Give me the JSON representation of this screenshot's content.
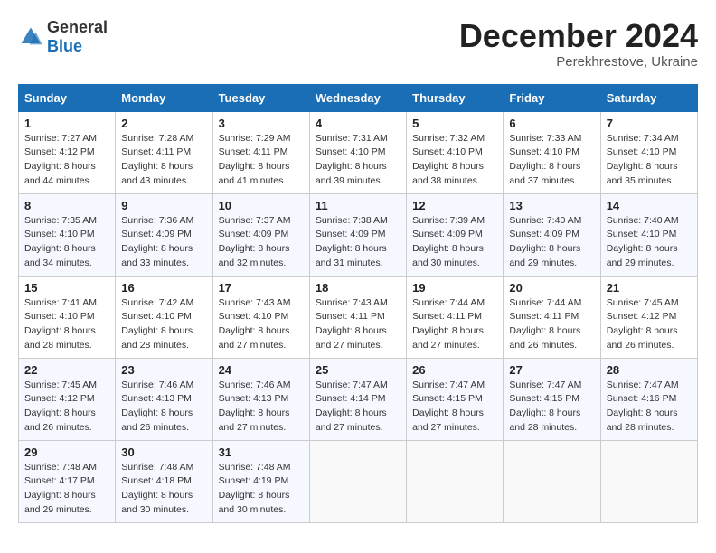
{
  "header": {
    "logo_general": "General",
    "logo_blue": "Blue",
    "title": "December 2024",
    "subtitle": "Perekhrestove, Ukraine"
  },
  "days_of_week": [
    "Sunday",
    "Monday",
    "Tuesday",
    "Wednesday",
    "Thursday",
    "Friday",
    "Saturday"
  ],
  "weeks": [
    [
      {
        "day": "1",
        "sunrise": "Sunrise: 7:27 AM",
        "sunset": "Sunset: 4:12 PM",
        "daylight": "Daylight: 8 hours and 44 minutes."
      },
      {
        "day": "2",
        "sunrise": "Sunrise: 7:28 AM",
        "sunset": "Sunset: 4:11 PM",
        "daylight": "Daylight: 8 hours and 43 minutes."
      },
      {
        "day": "3",
        "sunrise": "Sunrise: 7:29 AM",
        "sunset": "Sunset: 4:11 PM",
        "daylight": "Daylight: 8 hours and 41 minutes."
      },
      {
        "day": "4",
        "sunrise": "Sunrise: 7:31 AM",
        "sunset": "Sunset: 4:10 PM",
        "daylight": "Daylight: 8 hours and 39 minutes."
      },
      {
        "day": "5",
        "sunrise": "Sunrise: 7:32 AM",
        "sunset": "Sunset: 4:10 PM",
        "daylight": "Daylight: 8 hours and 38 minutes."
      },
      {
        "day": "6",
        "sunrise": "Sunrise: 7:33 AM",
        "sunset": "Sunset: 4:10 PM",
        "daylight": "Daylight: 8 hours and 37 minutes."
      },
      {
        "day": "7",
        "sunrise": "Sunrise: 7:34 AM",
        "sunset": "Sunset: 4:10 PM",
        "daylight": "Daylight: 8 hours and 35 minutes."
      }
    ],
    [
      {
        "day": "8",
        "sunrise": "Sunrise: 7:35 AM",
        "sunset": "Sunset: 4:10 PM",
        "daylight": "Daylight: 8 hours and 34 minutes."
      },
      {
        "day": "9",
        "sunrise": "Sunrise: 7:36 AM",
        "sunset": "Sunset: 4:09 PM",
        "daylight": "Daylight: 8 hours and 33 minutes."
      },
      {
        "day": "10",
        "sunrise": "Sunrise: 7:37 AM",
        "sunset": "Sunset: 4:09 PM",
        "daylight": "Daylight: 8 hours and 32 minutes."
      },
      {
        "day": "11",
        "sunrise": "Sunrise: 7:38 AM",
        "sunset": "Sunset: 4:09 PM",
        "daylight": "Daylight: 8 hours and 31 minutes."
      },
      {
        "day": "12",
        "sunrise": "Sunrise: 7:39 AM",
        "sunset": "Sunset: 4:09 PM",
        "daylight": "Daylight: 8 hours and 30 minutes."
      },
      {
        "day": "13",
        "sunrise": "Sunrise: 7:40 AM",
        "sunset": "Sunset: 4:09 PM",
        "daylight": "Daylight: 8 hours and 29 minutes."
      },
      {
        "day": "14",
        "sunrise": "Sunrise: 7:40 AM",
        "sunset": "Sunset: 4:10 PM",
        "daylight": "Daylight: 8 hours and 29 minutes."
      }
    ],
    [
      {
        "day": "15",
        "sunrise": "Sunrise: 7:41 AM",
        "sunset": "Sunset: 4:10 PM",
        "daylight": "Daylight: 8 hours and 28 minutes."
      },
      {
        "day": "16",
        "sunrise": "Sunrise: 7:42 AM",
        "sunset": "Sunset: 4:10 PM",
        "daylight": "Daylight: 8 hours and 28 minutes."
      },
      {
        "day": "17",
        "sunrise": "Sunrise: 7:43 AM",
        "sunset": "Sunset: 4:10 PM",
        "daylight": "Daylight: 8 hours and 27 minutes."
      },
      {
        "day": "18",
        "sunrise": "Sunrise: 7:43 AM",
        "sunset": "Sunset: 4:11 PM",
        "daylight": "Daylight: 8 hours and 27 minutes."
      },
      {
        "day": "19",
        "sunrise": "Sunrise: 7:44 AM",
        "sunset": "Sunset: 4:11 PM",
        "daylight": "Daylight: 8 hours and 27 minutes."
      },
      {
        "day": "20",
        "sunrise": "Sunrise: 7:44 AM",
        "sunset": "Sunset: 4:11 PM",
        "daylight": "Daylight: 8 hours and 26 minutes."
      },
      {
        "day": "21",
        "sunrise": "Sunrise: 7:45 AM",
        "sunset": "Sunset: 4:12 PM",
        "daylight": "Daylight: 8 hours and 26 minutes."
      }
    ],
    [
      {
        "day": "22",
        "sunrise": "Sunrise: 7:45 AM",
        "sunset": "Sunset: 4:12 PM",
        "daylight": "Daylight: 8 hours and 26 minutes."
      },
      {
        "day": "23",
        "sunrise": "Sunrise: 7:46 AM",
        "sunset": "Sunset: 4:13 PM",
        "daylight": "Daylight: 8 hours and 26 minutes."
      },
      {
        "day": "24",
        "sunrise": "Sunrise: 7:46 AM",
        "sunset": "Sunset: 4:13 PM",
        "daylight": "Daylight: 8 hours and 27 minutes."
      },
      {
        "day": "25",
        "sunrise": "Sunrise: 7:47 AM",
        "sunset": "Sunset: 4:14 PM",
        "daylight": "Daylight: 8 hours and 27 minutes."
      },
      {
        "day": "26",
        "sunrise": "Sunrise: 7:47 AM",
        "sunset": "Sunset: 4:15 PM",
        "daylight": "Daylight: 8 hours and 27 minutes."
      },
      {
        "day": "27",
        "sunrise": "Sunrise: 7:47 AM",
        "sunset": "Sunset: 4:15 PM",
        "daylight": "Daylight: 8 hours and 28 minutes."
      },
      {
        "day": "28",
        "sunrise": "Sunrise: 7:47 AM",
        "sunset": "Sunset: 4:16 PM",
        "daylight": "Daylight: 8 hours and 28 minutes."
      }
    ],
    [
      {
        "day": "29",
        "sunrise": "Sunrise: 7:48 AM",
        "sunset": "Sunset: 4:17 PM",
        "daylight": "Daylight: 8 hours and 29 minutes."
      },
      {
        "day": "30",
        "sunrise": "Sunrise: 7:48 AM",
        "sunset": "Sunset: 4:18 PM",
        "daylight": "Daylight: 8 hours and 30 minutes."
      },
      {
        "day": "31",
        "sunrise": "Sunrise: 7:48 AM",
        "sunset": "Sunset: 4:19 PM",
        "daylight": "Daylight: 8 hours and 30 minutes."
      },
      null,
      null,
      null,
      null
    ]
  ]
}
